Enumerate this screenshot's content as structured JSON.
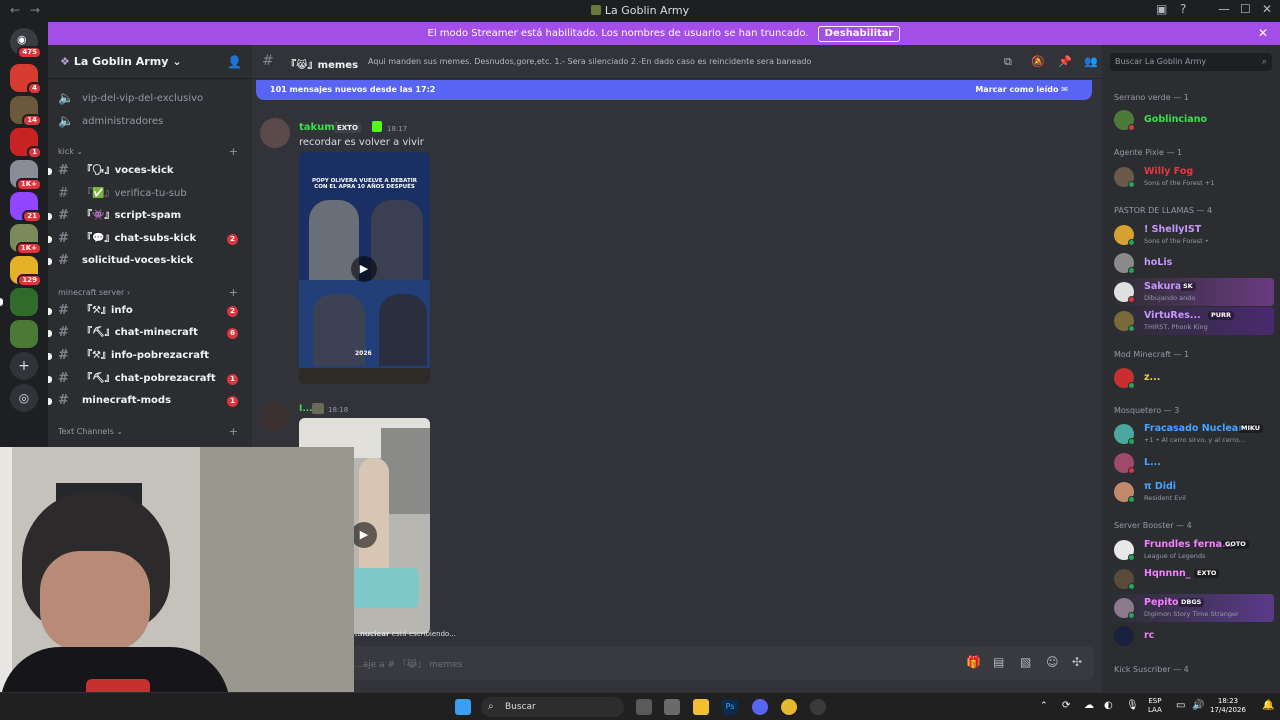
{
  "window": {
    "title": "La Goblin Army"
  },
  "guild_badges": [
    "475",
    "4",
    "14",
    "1",
    "1K+",
    "21",
    "1K+",
    "129"
  ],
  "streamer_banner": {
    "text": "El modo Streamer está habilitado. Los nombres de usuario se han truncado.",
    "button": "Deshabilitar"
  },
  "server": {
    "name": "La Goblin Army",
    "channels_top": [
      {
        "label": "vip-del-vip-del-exclusivo"
      },
      {
        "label": "administradores"
      }
    ],
    "categories": {
      "kick": "kick",
      "minecraft": "minecraft server",
      "text": "Text Channels"
    },
    "kick_channels": [
      {
        "label": "『🗣』voces-kick",
        "unread": true,
        "count": ""
      },
      {
        "label": "『✅』verifica-tu-sub",
        "unread": false,
        "count": ""
      },
      {
        "label": "『👾』script-spam",
        "unread": true,
        "count": ""
      },
      {
        "label": "『💬』chat-subs-kick",
        "unread": true,
        "count": "2"
      },
      {
        "label": "solicitud-voces-kick",
        "unread": true,
        "count": ""
      }
    ],
    "mc_channels": [
      {
        "label": "『⚒』info",
        "unread": true,
        "count": "2"
      },
      {
        "label": "『⛏』chat-minecraft",
        "unread": true,
        "count": "6"
      },
      {
        "label": "『⚒』info-pobrezacraft",
        "unread": true,
        "count": ""
      },
      {
        "label": "『⛏』chat-pobrezacraft",
        "unread": true,
        "count": "1"
      },
      {
        "label": "minecraft-mods",
        "unread": true,
        "count": "1"
      }
    ]
  },
  "channel": {
    "name": "『😹』memes",
    "topic": "Aqui manden sus memes. Desnudos,gore,etc. 1.- Sera silenciado 2.-En dado caso es reincidente sera baneado",
    "new_messages": "101 mensajes nuevos desde las 17:2",
    "mark_read": "Marcar como leído"
  },
  "messages": [
    {
      "user": "takumi",
      "tag": "EXTO",
      "time": "18:17",
      "text": "recordar es volver a vivir",
      "media_caption_1": "POPY OLIVERA VUELVE A DEBATIR CON EL APRA 10 AÑOS DESPUÉS",
      "media_caption_2": "2026"
    },
    {
      "user": "I...",
      "time": "18:18"
    }
  ],
  "typing": {
    "user": "...nuclear",
    "text": " está escribiendo..."
  },
  "composer": {
    "placeholder": "...aje a # 『😹』 memes"
  },
  "members": {
    "search_placeholder": "Buscar La Goblin Army",
    "groups": [
      {
        "label": "Serrano verde — 1"
      },
      {
        "label": "Agente Pixie — 1"
      },
      {
        "label": "PASTOR DE LLAMAS — 4"
      },
      {
        "label": "Mod Minecraft — 1"
      },
      {
        "label": "Mosquetero — 3"
      },
      {
        "label": "Server Booster — 4"
      },
      {
        "label": "Kick Suscriber — 4"
      }
    ],
    "list": [
      {
        "name": "Goblinciano",
        "sub": "",
        "tag": "",
        "color": "#3ce04d"
      },
      {
        "name": "Willy Fog",
        "sub": "Sons of the Forest +1",
        "tag": "",
        "color": "#e8383d"
      },
      {
        "name": "! ShellyIST",
        "sub": "Sons of the Forest •",
        "tag": "",
        "color": "#c896ff"
      },
      {
        "name": "hoLis",
        "sub": "",
        "tag": "",
        "color": "#c896ff"
      },
      {
        "name": "Sakura",
        "sub": "Dibujando ando",
        "tag": "SK",
        "color": "#c896ff"
      },
      {
        "name": "VirtuRes...",
        "sub": "THIRST, Phonk King",
        "tag": "PURR",
        "color": "#c896ff"
      },
      {
        "name": "z...",
        "sub": "",
        "tag": "",
        "color": "#f0d23c"
      },
      {
        "name": "Fracasado Nuclear",
        "sub": "+1 • Al cerro sirvo, y al cerro...",
        "tag": "MIKU",
        "color": "#45a4ff"
      },
      {
        "name": "L...",
        "sub": "",
        "tag": "",
        "color": "#45a4ff"
      },
      {
        "name": "π Didi",
        "sub": "Resident Evil",
        "tag": "",
        "color": "#45a4ff"
      },
      {
        "name": "Frundles ferna...",
        "sub": "League of Legends",
        "tag": "GOTO",
        "color": "#f47fff"
      },
      {
        "name": "Hqnnnn_",
        "sub": "",
        "tag": "EXTO",
        "color": "#f47fff"
      },
      {
        "name": "Pepito",
        "sub": "Digimon Story Time Stranger",
        "tag": "DBGS",
        "color": "#f47fff"
      },
      {
        "name": "rc",
        "sub": "",
        "tag": "",
        "color": "#f47fff"
      }
    ]
  },
  "taskbar": {
    "search": "Buscar",
    "lang": "ESP",
    "layout": "LAA",
    "time": "18:23",
    "date": "17/4/2026"
  },
  "colors": {
    "brand": "#5865f2",
    "streamer": "#a34ee6",
    "online": "#23a55a"
  }
}
